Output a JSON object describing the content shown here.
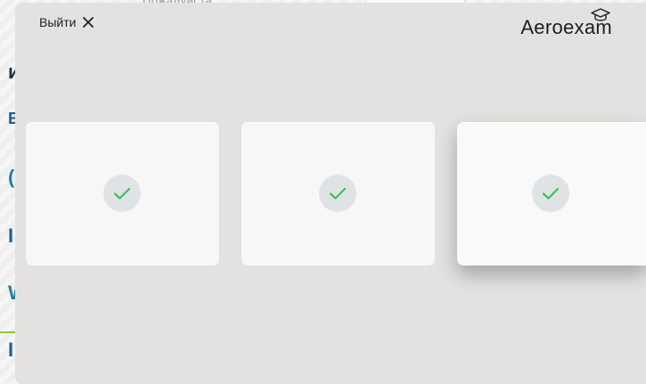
{
  "background": {
    "top_text": "Пожалуйста",
    "edge_marks": [
      {
        "text": "и",
        "style": "dark"
      },
      {
        "text": "Е",
        "style": "blue"
      },
      {
        "text": "(",
        "style": "teal"
      },
      {
        "text": "I",
        "style": "blue"
      },
      {
        "text": "W",
        "style": "teal"
      },
      {
        "text": "I",
        "style": "blue"
      }
    ]
  },
  "modal": {
    "exit_label": "Выйти",
    "close_icon": "close-icon",
    "brand": {
      "name": "Aeroexam",
      "icon": "graduation-cap-icon"
    },
    "cards": [
      {
        "status": "completed",
        "icon": "check-icon"
      },
      {
        "status": "completed",
        "icon": "check-icon"
      },
      {
        "status": "completed",
        "icon": "check-icon"
      }
    ]
  },
  "colors": {
    "overlay": "#e3e2e0",
    "card": "#f7f7f7",
    "badge": "#e0e3e6",
    "check": "#3bbf5a",
    "accent_line": "#8cc63f"
  }
}
